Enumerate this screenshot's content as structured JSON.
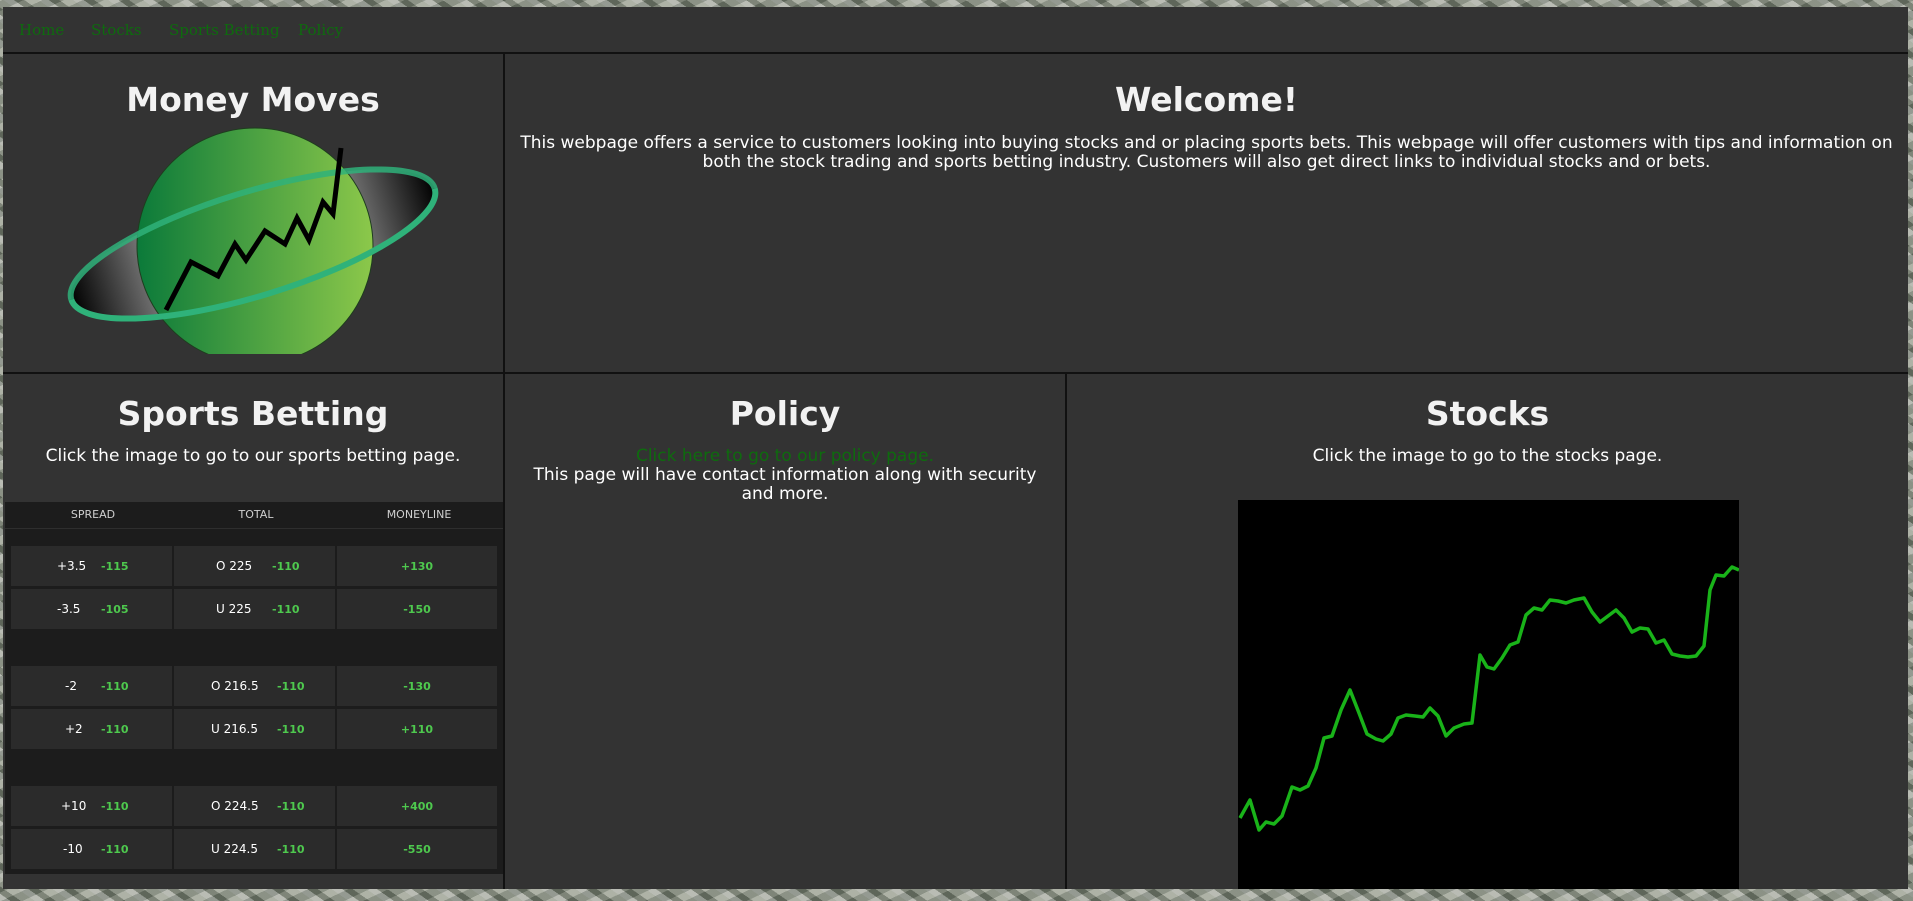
{
  "nav": {
    "items": [
      "Home",
      "Stocks",
      "Sports Betting",
      "Policy"
    ]
  },
  "logo_panel": {
    "title": "Money Moves"
  },
  "welcome": {
    "title": "Welcome!",
    "text": "This webpage offers a service to customers looking into buying stocks and or placing sports bets. This webpage will offer customers with tips and information on both the stock trading and sports betting industry. Customers will also get direct links to individual stocks and or bets."
  },
  "sports": {
    "title": "Sports Betting",
    "text": "Click the image to go to our sports betting page.",
    "headers": [
      "SPREAD",
      "TOTAL",
      "MONEYLINE"
    ],
    "games": [
      {
        "rows": [
          {
            "spread": "+3.5",
            "spread_odds": "-115",
            "total": "O 225",
            "total_odds": "-110",
            "moneyline": "+130"
          },
          {
            "spread": "-3.5",
            "spread_odds": "-105",
            "total": "U 225",
            "total_odds": "-110",
            "moneyline": "-150"
          }
        ]
      },
      {
        "rows": [
          {
            "spread": "-2",
            "spread_odds": "-110",
            "total": "O 216.5",
            "total_odds": "-110",
            "moneyline": "-130"
          },
          {
            "spread": "+2",
            "spread_odds": "-110",
            "total": "U 216.5",
            "total_odds": "-110",
            "moneyline": "+110"
          }
        ]
      },
      {
        "rows": [
          {
            "spread": "+10",
            "spread_odds": "-110",
            "total": "O 224.5",
            "total_odds": "-110",
            "moneyline": "+400"
          },
          {
            "spread": "-10",
            "spread_odds": "-110",
            "total": "U 224.5",
            "total_odds": "-110",
            "moneyline": "-550"
          }
        ]
      }
    ]
  },
  "policy": {
    "title": "Policy",
    "link": "Click here to go to our policy page.",
    "text": "This page will have contact information along with security and more."
  },
  "stocks": {
    "title": "Stocks",
    "text": "Click the image to go to the stocks page."
  },
  "colors": {
    "panel": "#333333",
    "link": "#0e6b0e",
    "odds_green": "#4ec94e",
    "stock_line": "#19b319"
  }
}
